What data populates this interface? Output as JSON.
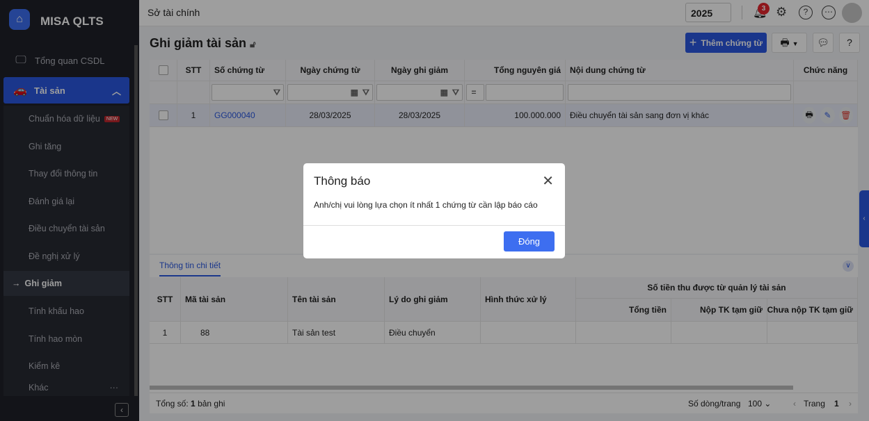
{
  "app": {
    "brand": "MISA QLTS",
    "org": "Sở tài chính",
    "year": "2025",
    "notifications": "3"
  },
  "sidebar": {
    "overview": "Tổng quan CSDL",
    "assets": "Tài sản",
    "new_badge": "NEW",
    "items": [
      "Chuẩn hóa dữ liệu",
      "Ghi tăng",
      "Thay đổi thông tin",
      "Đánh giá lại",
      "Điều chuyển tài sản",
      "Đề nghị xử lý",
      "Ghi giảm",
      "Tính khấu hao",
      "Tính hao mòn",
      "Kiểm kê",
      "Khác"
    ]
  },
  "page": {
    "title": "Ghi giảm tài sản",
    "add_button": "Thêm chứng từ"
  },
  "grid": {
    "headers": [
      "STT",
      "Số chứng từ",
      "Ngày chứng từ",
      "Ngày ghi giảm",
      "Tổng nguyên giá",
      "Nội dung chứng từ",
      "Chức năng"
    ],
    "filter_eq": "=",
    "rows": [
      {
        "stt": "1",
        "doc_no": "GG000040",
        "doc_date": "28/03/2025",
        "reduce_date": "28/03/2025",
        "total": "100.000.000",
        "content": "Điều chuyển tài sản sang đơn vị khác"
      }
    ]
  },
  "detail": {
    "tab": "Thông tin chi tiết",
    "headers": {
      "stt": "STT",
      "code": "Mã tài sản",
      "name": "Tên tài sản",
      "reason": "Lý do ghi giảm",
      "method": "Hình thức xử lý",
      "group": "Số tiền thu được từ quản lý tài sản",
      "total": "Tổng tiền",
      "paid": "Nộp TK tạm giữ",
      "unpaid": "Chưa nộp TK tạm giữ"
    },
    "rows": [
      {
        "stt": "1",
        "code": "88",
        "name": "Tài sản test",
        "reason": "Điều chuyển"
      }
    ]
  },
  "footer": {
    "total_label": "Tổng số:",
    "total_count": "1",
    "total_suffix": "bản ghi",
    "page_size_label": "Số dòng/trang",
    "page_size": "100",
    "page_label": "Trang",
    "page": "1"
  },
  "modal": {
    "title": "Thông báo",
    "message": "Anh/chị vui lòng lựa chọn ít nhất 1 chứng từ cần lập báo cáo",
    "close_button": "Đóng"
  }
}
